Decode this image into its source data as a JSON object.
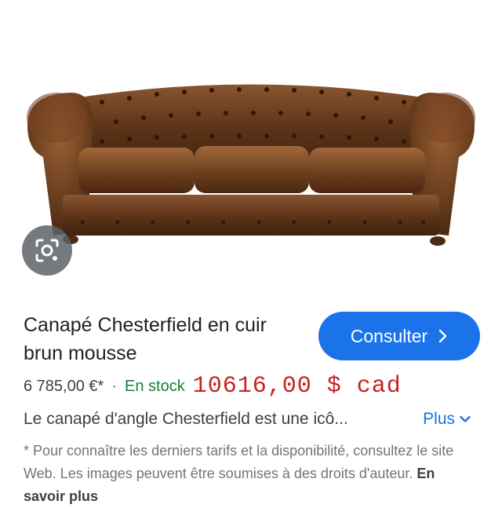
{
  "product": {
    "image_alt": "brown leather chesterfield sofa",
    "title": "Canapé Chesterfield en cuir brun mousse",
    "price": "6 785,00 €*",
    "separator": "·",
    "stock": "En stock",
    "price_annotation": "10616,00 $ cad",
    "description": "Le canapé d'angle Chesterfield est une icô...",
    "more_label": "Plus",
    "disclaimer": "* Pour connaître les derniers tarifs et la disponibilité, consultez le site Web. Les images peuvent être soumises à des droits d'auteur.",
    "learn_more": "En savoir plus"
  },
  "actions": {
    "consult_label": "Consulter"
  },
  "icons": {
    "lens": "google-lens-icon",
    "consult_chevron": "chevron-right-icon",
    "more_chevron": "chevron-down-icon"
  },
  "colors": {
    "accent": "#1a73e8",
    "stock_green": "#188038",
    "annotation_red": "#c5221f",
    "leather_brown": "#6b3e1f"
  }
}
